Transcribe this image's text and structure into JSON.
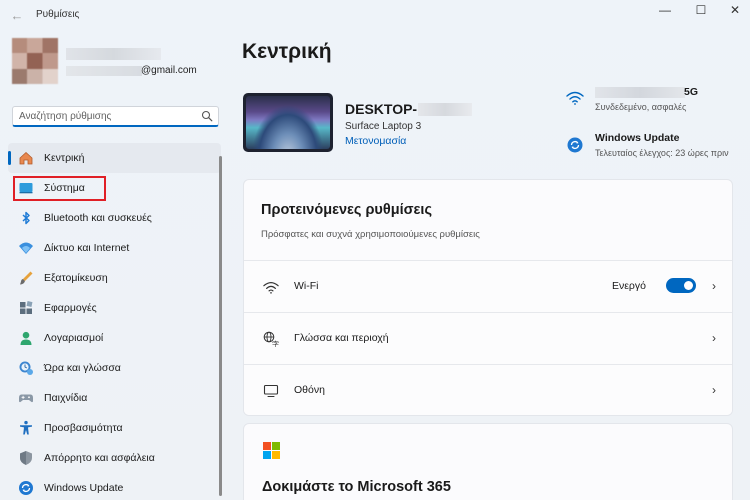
{
  "window": {
    "title": "Ρυθμίσεις",
    "controls": {
      "minimize": "—",
      "maximize": "☐",
      "close": "✕"
    },
    "back_icon": "←"
  },
  "profile": {
    "email_suffix": "@gmail.com"
  },
  "search": {
    "placeholder": "Αναζήτηση ρύθμισης"
  },
  "sidebar": {
    "items": [
      {
        "label": "Κεντρική",
        "icon": "home-icon",
        "active": true
      },
      {
        "label": "Σύστημα",
        "icon": "system-icon",
        "active": false,
        "highlighted": true
      },
      {
        "label": "Bluetooth και συσκευές",
        "icon": "bluetooth-icon",
        "active": false
      },
      {
        "label": "Δίκτυο και Internet",
        "icon": "network-icon",
        "active": false
      },
      {
        "label": "Εξατομίκευση",
        "icon": "personalization-icon",
        "active": false
      },
      {
        "label": "Εφαρμογές",
        "icon": "apps-icon",
        "active": false
      },
      {
        "label": "Λογαριασμοί",
        "icon": "accounts-icon",
        "active": false
      },
      {
        "label": "Ώρα και γλώσσα",
        "icon": "time-language-icon",
        "active": false
      },
      {
        "label": "Παιχνίδια",
        "icon": "gaming-icon",
        "active": false
      },
      {
        "label": "Προσβασιμότητα",
        "icon": "accessibility-icon",
        "active": false
      },
      {
        "label": "Απόρρητο και ασφάλεια",
        "icon": "privacy-icon",
        "active": false
      },
      {
        "label": "Windows Update",
        "icon": "windows-update-icon",
        "active": false
      }
    ]
  },
  "main": {
    "title": "Κεντρική",
    "device": {
      "name_prefix": "DESKTOP-",
      "model": "Surface Laptop 3",
      "rename_link": "Μετονομασία"
    },
    "status": {
      "wifi": {
        "name_suffix": "5G",
        "status": "Συνδεδεμένο, ασφαλές"
      },
      "windows_update": {
        "title": "Windows Update",
        "subtitle": "Τελευταίος έλεγχος: 23 ώρες πριν"
      }
    },
    "recommended": {
      "title": "Προτεινόμενες ρυθμίσεις",
      "subtitle": "Πρόσφατες και συχνά χρησιμοποιούμενες ρυθμίσεις",
      "rows": [
        {
          "label": "Wi-Fi",
          "icon": "wifi-icon",
          "toggle_label": "Ενεργό",
          "toggle_on": true
        },
        {
          "label": "Γλώσσα και περιοχή",
          "icon": "language-region-icon"
        },
        {
          "label": "Οθόνη",
          "icon": "display-icon"
        }
      ],
      "chevron": "›"
    },
    "microsoft365": {
      "title": "Δοκιμάστε το Microsoft 365"
    }
  },
  "colors": {
    "accent": "#0067c0",
    "highlight_box": "#e01f26"
  }
}
